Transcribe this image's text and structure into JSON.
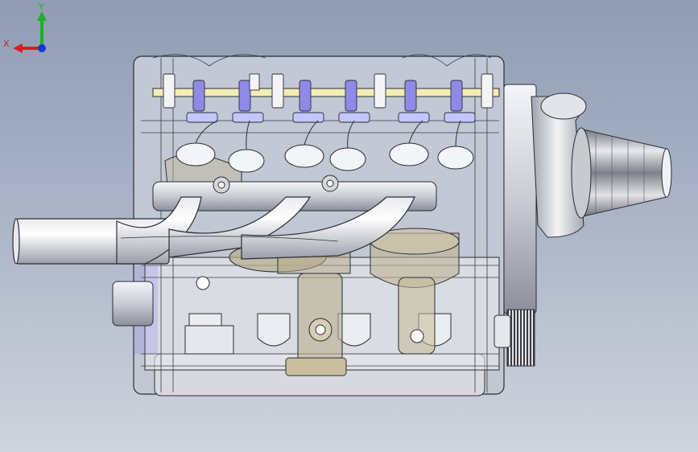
{
  "viewport": {
    "background_top": "#8f9cb3",
    "background_bottom": "#cfd4dd",
    "model": "engine-assembly"
  },
  "triad": {
    "x_label": "X",
    "y_label": "Y",
    "x_color": "#d81e1e",
    "y_color": "#1fae2b",
    "z_color": "#1c34d6"
  }
}
